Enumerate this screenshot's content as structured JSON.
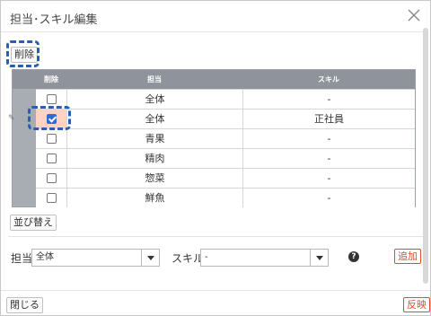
{
  "dialog": {
    "title": "担当･スキル編集"
  },
  "toolbar": {
    "delete_label": "削除",
    "reorder_label": "並び替え"
  },
  "grid": {
    "headers": {
      "delete": "削除",
      "tanto": "担当",
      "skill": "スキル"
    },
    "handle_glyph": "✎",
    "rows": [
      {
        "tanto": "全体",
        "skill": "-",
        "checked": false
      },
      {
        "tanto": "全体",
        "skill": "正社員",
        "checked": true
      },
      {
        "tanto": "青果",
        "skill": "-",
        "checked": false
      },
      {
        "tanto": "精肉",
        "skill": "-",
        "checked": false
      },
      {
        "tanto": "惣菜",
        "skill": "-",
        "checked": false
      },
      {
        "tanto": "鮮魚",
        "skill": "-",
        "checked": false
      }
    ]
  },
  "form": {
    "tanto_label": "担当",
    "tanto_value": "全体",
    "skill_label": "スキル",
    "skill_value": "-",
    "help_glyph": "?",
    "add_label": "追加"
  },
  "footer": {
    "close_label": "閉じる",
    "apply_label": "反映"
  },
  "colors": {
    "accent_blue": "#2b5fae",
    "danger": "#e24b2d",
    "highlight": "#ffd2c4"
  }
}
